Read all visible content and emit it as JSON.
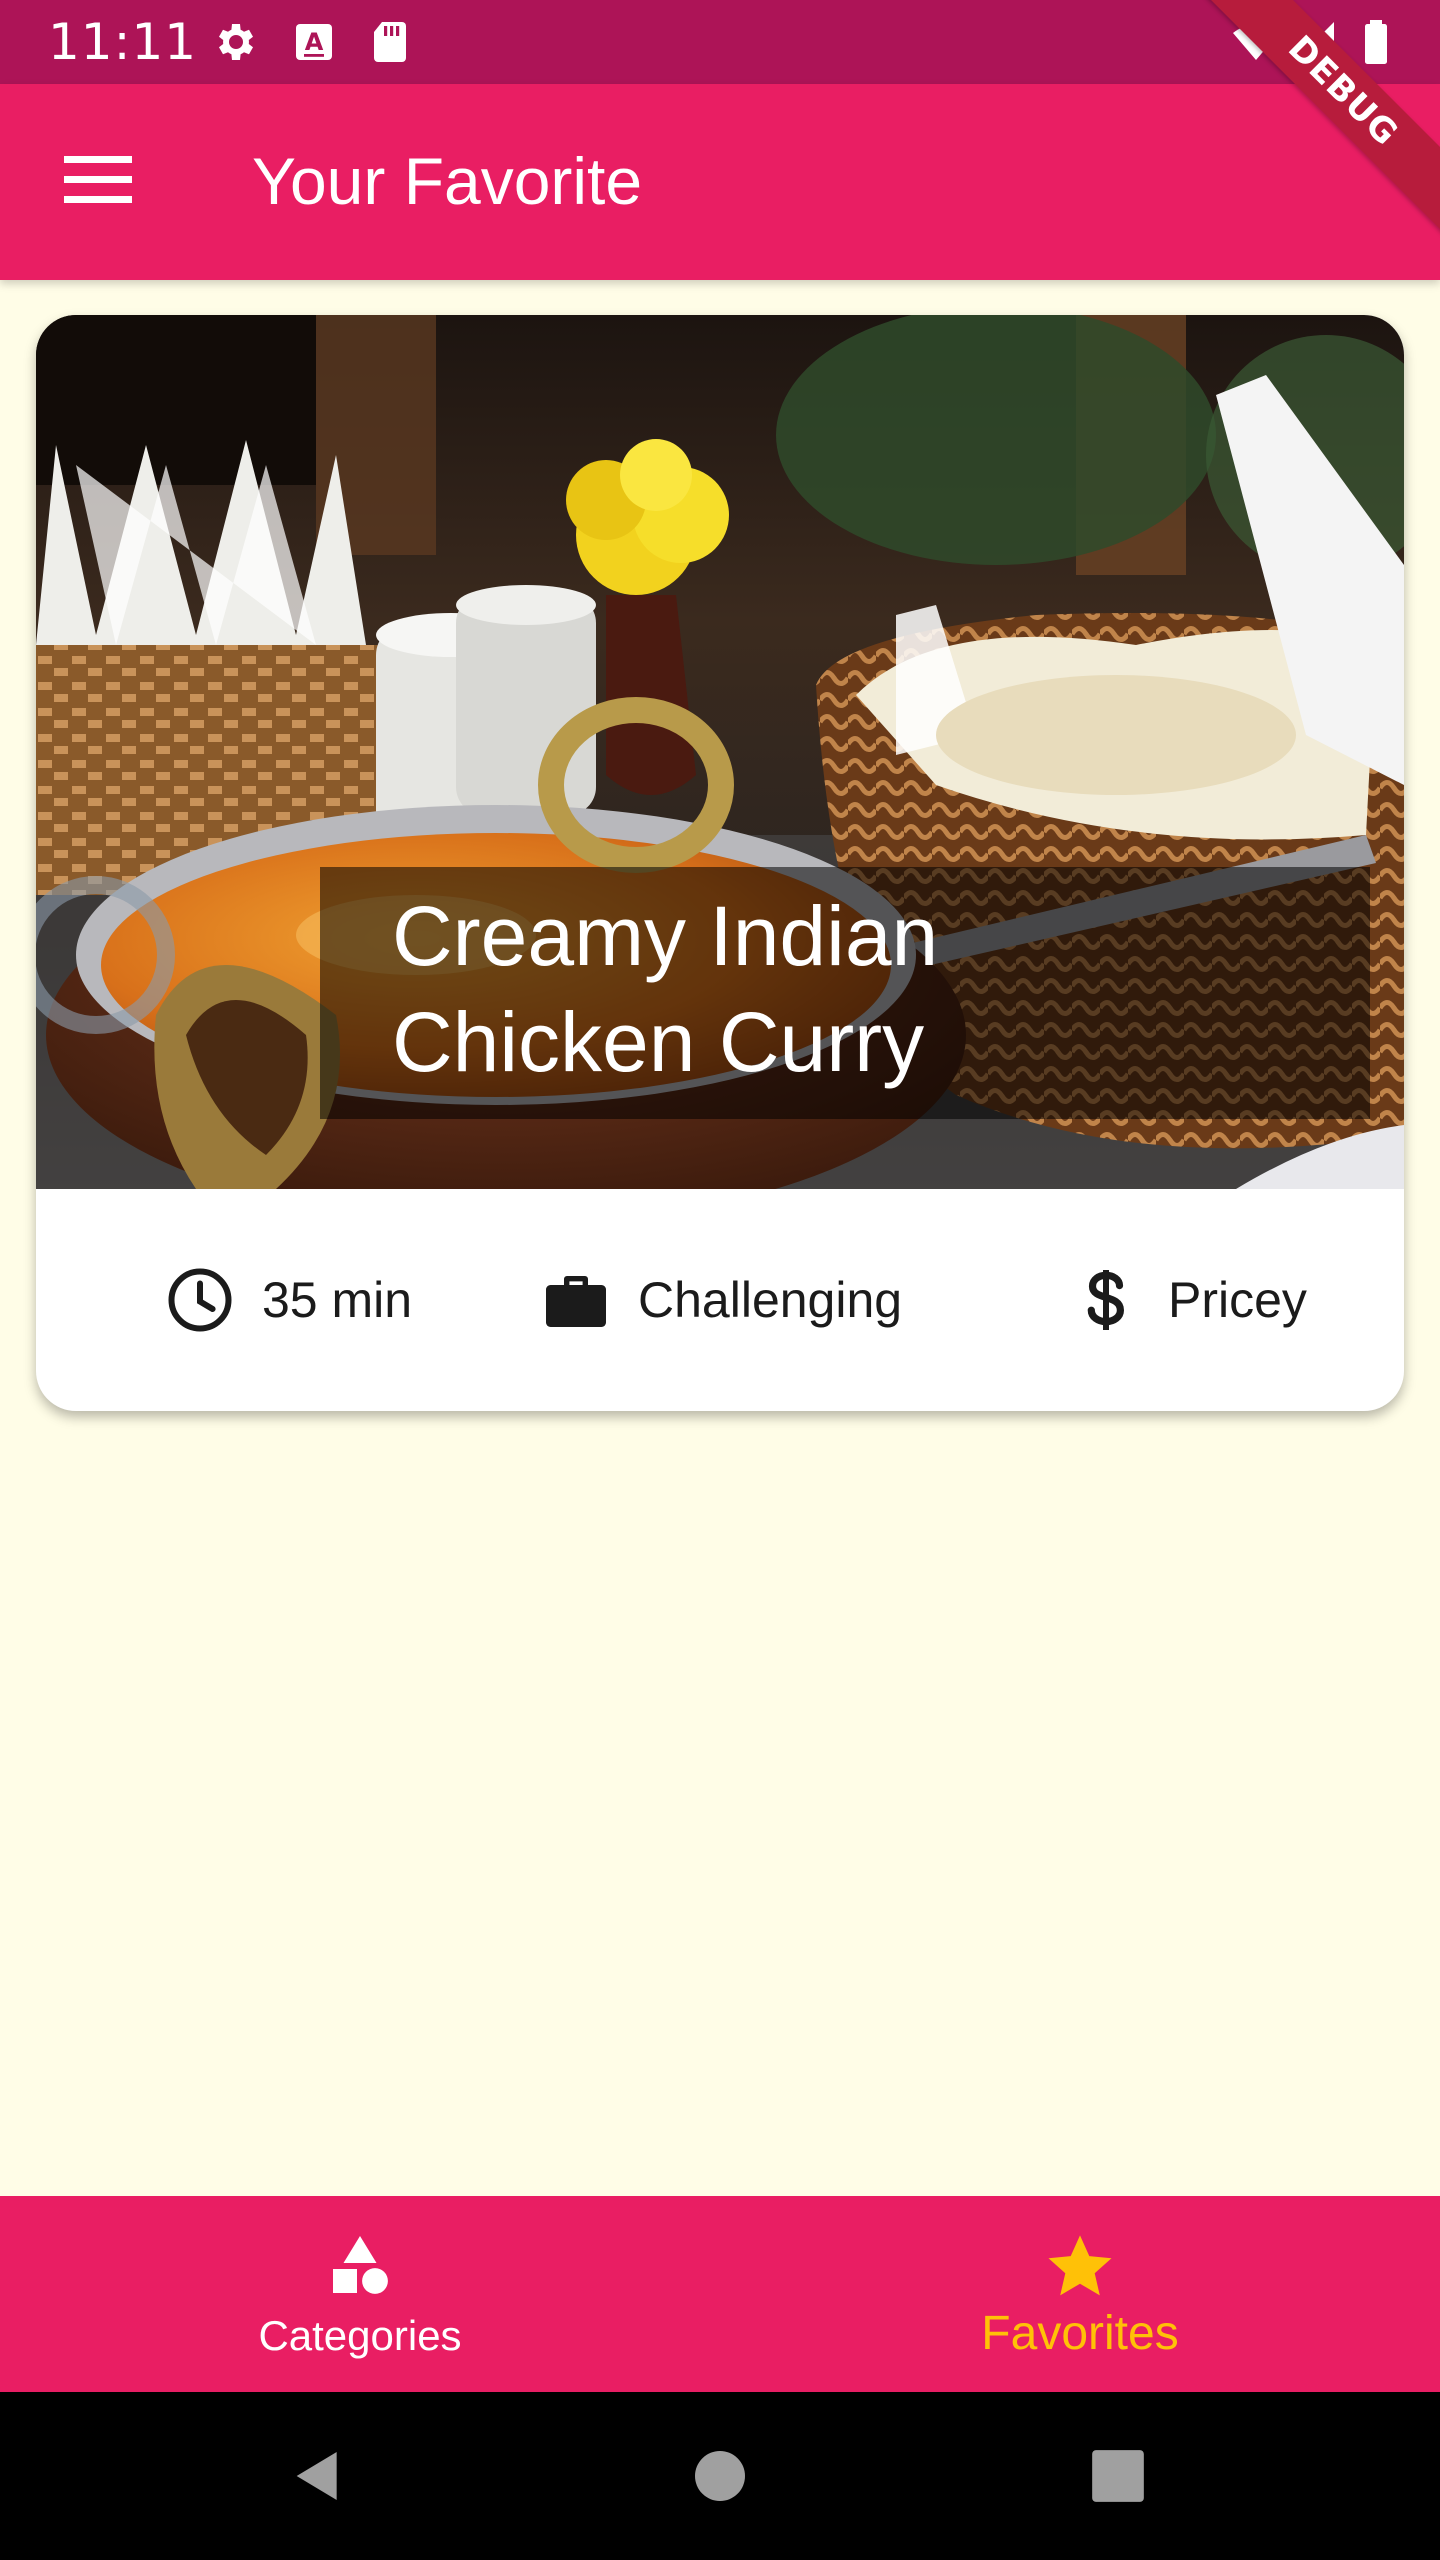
{
  "status_bar": {
    "time": "11:11",
    "icons": [
      "gear-icon",
      "a-keyboard-icon",
      "sd-card-icon",
      "wifi-icon",
      "signal-icon",
      "battery-icon"
    ],
    "background": "#ad1457"
  },
  "debug_banner": "DEBUG",
  "app_bar": {
    "title": "Your Favorite",
    "menu_icon": "menu-icon",
    "background": "#e91e63"
  },
  "meal_card": {
    "title": "Creamy Indian\nChicken Curry",
    "image_alt": "curry bowl with naan basket photo",
    "duration": "35 min",
    "duration_icon": "clock-icon",
    "complexity": "Challenging",
    "complexity_icon": "briefcase-icon",
    "affordability": "Pricey",
    "affordability_icon": "dollar-icon"
  },
  "bottom_nav": {
    "background": "#e91e63",
    "items": [
      {
        "label": "Categories",
        "icon": "category-shapes-icon",
        "selected": false,
        "color": "#ffffff"
      },
      {
        "label": "Favorites",
        "icon": "star-icon",
        "selected": true,
        "color": "#ffc107"
      }
    ]
  },
  "system_nav": {
    "buttons": [
      "back-icon",
      "home-icon",
      "recents-icon"
    ]
  }
}
